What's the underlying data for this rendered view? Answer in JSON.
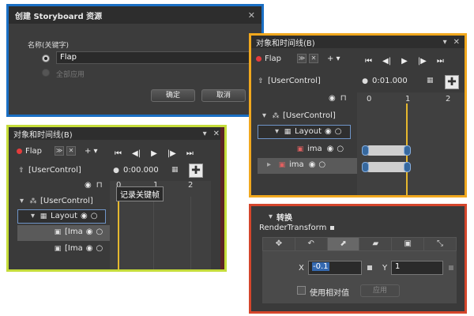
{
  "dialog": {
    "title": "创建 Storyboard 资源",
    "name_label": "名称(关键字)",
    "name_value": "Flap",
    "disabled_option": "全部应用",
    "ok_label": "确定",
    "cancel_label": "取消"
  },
  "timeline_a": {
    "title": "对象和时间线(B)",
    "storyboard": "Flap",
    "root": "[UserControl]",
    "time": "0:01.000",
    "ruler_ticks": [
      "0",
      "1",
      "2"
    ],
    "tree": {
      "usercontrol": "[UserControl]",
      "layout": "Layout",
      "image1": "ima",
      "image2": "ima"
    }
  },
  "timeline_b": {
    "title": "对象和时间线(B)",
    "storyboard": "Flap",
    "root": "[UserControl]",
    "time": "0:00.000",
    "ruler_ticks": [
      "0",
      "1",
      "2"
    ],
    "tooltip": "记录关键帧",
    "tree": {
      "usercontrol": "[UserControl]",
      "layout": "Layout",
      "image1": "[Ima",
      "image2": "[Ima"
    }
  },
  "transform": {
    "section": "转换",
    "property": "RenderTransform",
    "tabs": [
      "✥",
      "↶",
      "⬈",
      "▰",
      "▣",
      "⤡"
    ],
    "x_label": "X",
    "x_value": "-0.1",
    "y_label": "Y",
    "y_value": "1",
    "relative_label": "使用相对值",
    "apply_label": "应用"
  },
  "colors": {
    "accent_blue": "#1a6fc4",
    "accent_orange": "#f1a81e",
    "accent_lime": "#c5dc3a",
    "accent_red": "#d4462c",
    "playhead": "#e6b82e",
    "record": "#e43c3c"
  }
}
